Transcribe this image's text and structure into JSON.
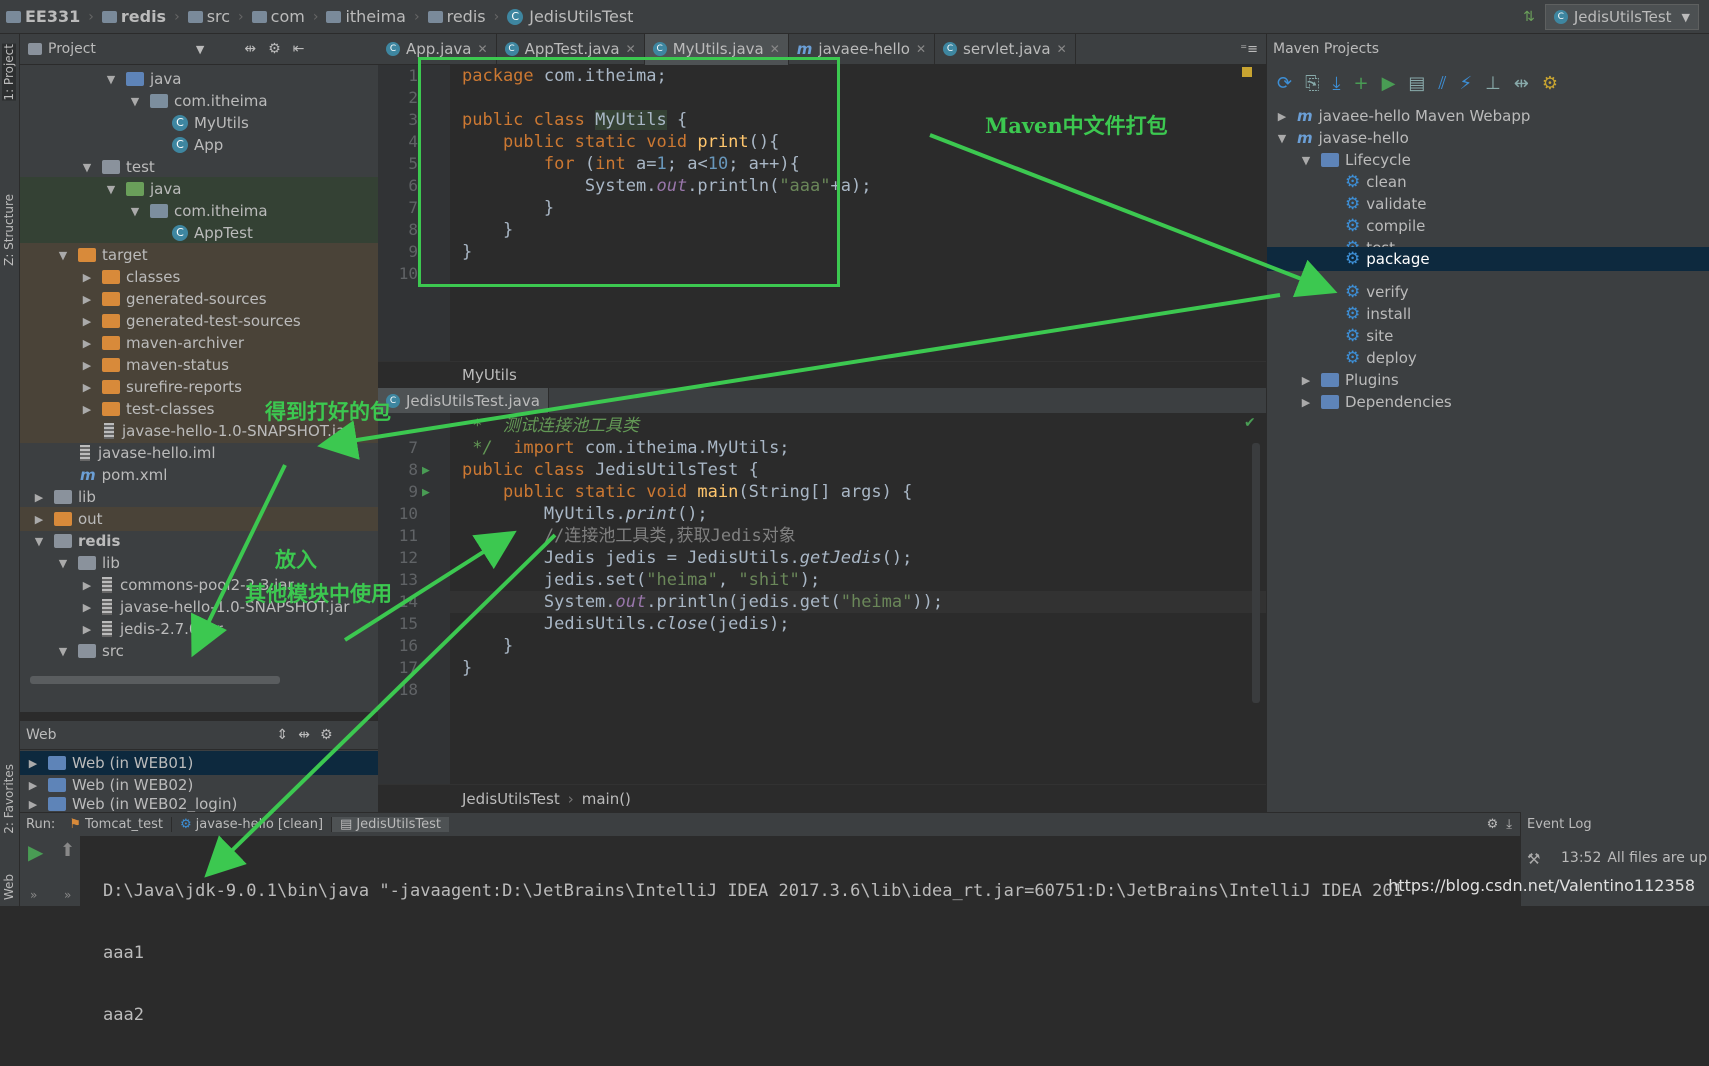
{
  "navbar": {
    "crumbs": [
      "EE331",
      "redis",
      "src",
      "com",
      "itheima",
      "redis",
      "JedisUtilsTest"
    ],
    "run_config": "JedisUtilsTest"
  },
  "left_stripe": {
    "project_tab": "1: Project",
    "structure_tab": "Z: Structure",
    "favorites_tab": "2: Favorites",
    "web_tab": "Web"
  },
  "project_panel": {
    "title": "Project",
    "tree": [
      "java",
      "com.itheima",
      "MyUtils",
      "App",
      "test",
      "java",
      "com.itheima",
      "AppTest",
      "target",
      "classes",
      "generated-sources",
      "generated-test-sources",
      "maven-archiver",
      "maven-status",
      "surefire-reports",
      "test-classes",
      "javase-hello-1.0-SNAPSHOT.jar",
      "javase-hello.iml",
      "pom.xml",
      "lib",
      "out",
      "redis",
      "lib",
      "commons-pool2-2.3.jar",
      "javase-hello-1.0-SNAPSHOT.jar",
      "jedis-2.7.0.jar",
      "src"
    ]
  },
  "web_panel": {
    "title": "Web",
    "items": [
      "Web (in WEB01)",
      "Web (in WEB02)",
      "Web (in WEB02_login)"
    ]
  },
  "editor_tabs": [
    "App.java",
    "AppTest.java",
    "MyUtils.java",
    "javaee-hello",
    "servlet.java"
  ],
  "editor_top": {
    "line_numbers": [
      "1",
      "2",
      "3",
      "4",
      "5",
      "6",
      "7",
      "8",
      "9",
      "10"
    ],
    "breadcrumb": "MyUtils",
    "code": {
      "l1a": "package",
      "l1b": " com.itheima;",
      "l3a": "public class ",
      "l3b": "MyUtils",
      "l3c": " {",
      "l4a": "    public static void ",
      "l4b": "print",
      "l4c": "(){",
      "l5a": "        for ",
      "l5b": "(",
      "l5c": "int ",
      "l5d": "a=",
      "l5e": "1",
      "l5f": "; a<",
      "l5g": "10",
      "l5h": "; a++){",
      "l6a": "            System.",
      "l6b": "out",
      "l6c": ".println(",
      "l6d": "\"aaa\"",
      "l6e": "+a);",
      "l7": "        }",
      "l8": "    }",
      "l9": "}"
    }
  },
  "editor_bottom": {
    "tab": "JedisUtilsTest.java",
    "line_numbers": [
      "7",
      "8",
      "9",
      "10",
      "11",
      "12",
      "13",
      "14",
      "15",
      "16",
      "17",
      "18"
    ],
    "breadcrumb": [
      "JedisUtilsTest",
      "main()"
    ],
    "code": {
      "l6": " *  测试连接池工具类",
      "l7a": " */  ",
      "l7b": "import ",
      "l7c": "com.itheima.MyUtils;",
      "l8a": "public class ",
      "l8b": "JedisUtilsTest",
      "l8c": " {",
      "l9a": "    public static void ",
      "l9b": "main",
      "l9c": "(String[] args) {",
      "l10a": "        MyUtils.",
      "l10b": "print",
      "l10c": "();",
      "l11": "        //连接池工具类,获取Jedis对象",
      "l12a": "        Jedis jedis = JedisUtils.",
      "l12b": "getJedis",
      "l12c": "();",
      "l13a": "        jedis.set(",
      "l13b": "\"heima\"",
      "l13c": ", ",
      "l13d": "\"shit\"",
      "l13e": ");",
      "l14a": "        System.",
      "l14b": "out",
      "l14c": ".println(jedis.get(",
      "l14d": "\"heima\"",
      "l14e": "));",
      "l15a": "        JedisUtils.",
      "l15b": "close",
      "l15c": "(jedis);",
      "l16": "    }",
      "l17": "}"
    }
  },
  "maven_panel": {
    "title": "Maven Projects",
    "projects": [
      "javaee-hello Maven Webapp",
      "javase-hello"
    ],
    "lifecycle_label": "Lifecycle",
    "lifecycle": [
      "clean",
      "validate",
      "compile",
      "test",
      "package",
      "verify",
      "install",
      "site",
      "deploy"
    ],
    "selected": "package",
    "plugins_label": "Plugins",
    "dependencies_label": "Dependencies"
  },
  "run_bar": {
    "label": "Run:",
    "tabs": [
      "Tomcat_test",
      "javase-hello [clean]",
      "JedisUtilsTest"
    ]
  },
  "console": {
    "lines": [
      "D:\\Java\\jdk-9.0.1\\bin\\java \"-javaagent:D:\\JetBrains\\IntelliJ IDEA 2017.3.6\\lib\\idea_rt.jar=60751:D:\\JetBrains\\IntelliJ IDEA 201",
      "aaa1",
      "aaa2"
    ]
  },
  "event_log": {
    "title": "Event Log",
    "time": "13:52",
    "message": "All files are up"
  },
  "annotations": {
    "maven_pack": "Maven中文件打包",
    "got_package": "得到打好的包",
    "put_in": "放入",
    "use_other": "其他模块中使用"
  },
  "watermark": "https://blog.csdn.net/Valentino112358",
  "colors": {
    "annotation": "#3cc850",
    "selection": "#0d293e",
    "editor_bg": "#2b2b2b"
  }
}
